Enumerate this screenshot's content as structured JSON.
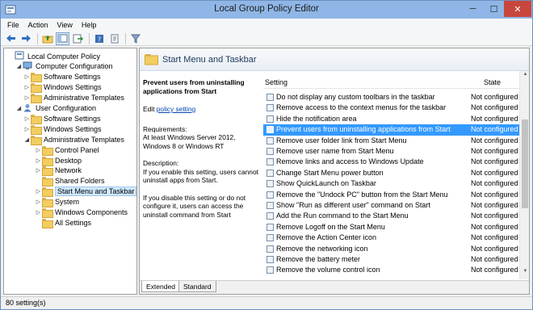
{
  "window": {
    "title": "Local Group Policy Editor",
    "minimize": "─",
    "maximize": "☐",
    "close": "✕"
  },
  "menu": [
    "File",
    "Action",
    "View",
    "Help"
  ],
  "toolbar": {
    "icons": [
      "back-icon",
      "forward-icon",
      "up-folder-icon",
      "show-hide-tree-icon",
      "export-list-icon",
      "help-icon",
      "properties-icon",
      "filter-icon"
    ]
  },
  "tree": [
    {
      "label": "Local Computer Policy",
      "level": 0,
      "arrow": ""
    },
    {
      "label": "Computer Configuration",
      "level": 1,
      "arrow": "◢"
    },
    {
      "label": "Software Settings",
      "level": 2,
      "arrow": "▷"
    },
    {
      "label": "Windows Settings",
      "level": 2,
      "arrow": "▷"
    },
    {
      "label": "Administrative Templates",
      "level": 2,
      "arrow": "▷"
    },
    {
      "label": "User Configuration",
      "level": 1,
      "arrow": "◢"
    },
    {
      "label": "Software Settings",
      "level": 2,
      "arrow": "▷"
    },
    {
      "label": "Windows Settings",
      "level": 2,
      "arrow": "▷"
    },
    {
      "label": "Administrative Templates",
      "level": 2,
      "arrow": "◢"
    },
    {
      "label": "Control Panel",
      "level": 3,
      "arrow": "▷"
    },
    {
      "label": "Desktop",
      "level": 3,
      "arrow": "▷"
    },
    {
      "label": "Network",
      "level": 3,
      "arrow": "▷"
    },
    {
      "label": "Shared Folders",
      "level": 3,
      "arrow": ""
    },
    {
      "label": "Start Menu and Taskbar",
      "level": 3,
      "arrow": "▷",
      "selected": true
    },
    {
      "label": "System",
      "level": 3,
      "arrow": "▷"
    },
    {
      "label": "Windows Components",
      "level": 3,
      "arrow": "▷"
    },
    {
      "label": "All Settings",
      "level": 3,
      "arrow": ""
    }
  ],
  "header": {
    "title": "Start Menu and Taskbar"
  },
  "description": {
    "title": "Prevent users from uninstalling applications from Start",
    "edit_prefix": "Edit",
    "edit_link": "policy setting",
    "requirements_label": "Requirements:",
    "requirements_text": "At least Windows Server 2012, Windows 8 or Windows RT",
    "description_label": "Description:",
    "para1": "If you enable this setting, users cannot uninstall apps from Start.",
    "para2": "If you disable this setting or do not configure it, users can access the uninstall command from Start"
  },
  "list": {
    "col_setting": "Setting",
    "col_state": "State",
    "rows": [
      {
        "name": "Do not display any custom toolbars in the taskbar",
        "state": "Not configured"
      },
      {
        "name": "Remove access to the context menus for the taskbar",
        "state": "Not configured"
      },
      {
        "name": "Hide the notification area",
        "state": "Not configured"
      },
      {
        "name": "Prevent users from uninstalling applications from Start",
        "state": "Not configured",
        "selected": true
      },
      {
        "name": "Remove user folder link from Start Menu",
        "state": "Not configured"
      },
      {
        "name": "Remove user name from Start Menu",
        "state": "Not configured"
      },
      {
        "name": "Remove links and access to Windows Update",
        "state": "Not configured"
      },
      {
        "name": "Change Start Menu power button",
        "state": "Not configured"
      },
      {
        "name": "Show QuickLaunch on Taskbar",
        "state": "Not configured"
      },
      {
        "name": "Remove the \"Undock PC\" button from the Start Menu",
        "state": "Not configured"
      },
      {
        "name": "Show \"Run as different user\" command on Start",
        "state": "Not configured"
      },
      {
        "name": "Add the Run command to the Start Menu",
        "state": "Not configured"
      },
      {
        "name": "Remove Logoff on the Start Menu",
        "state": "Not configured"
      },
      {
        "name": "Remove the Action Center icon",
        "state": "Not configured"
      },
      {
        "name": "Remove the networking icon",
        "state": "Not configured"
      },
      {
        "name": "Remove the battery meter",
        "state": "Not configured"
      },
      {
        "name": "Remove the volume control icon",
        "state": "Not configured"
      }
    ]
  },
  "tabs": {
    "extended": "Extended",
    "standard": "Standard"
  },
  "status": {
    "text": "80 setting(s)"
  }
}
